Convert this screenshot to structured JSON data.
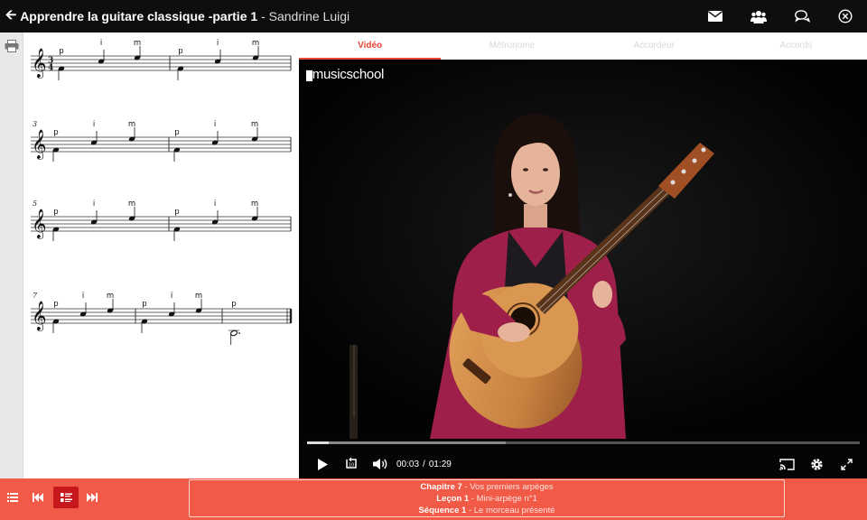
{
  "header": {
    "course_title": "Apprendre la guitare classique -partie 1",
    "separator": " - ",
    "author": "Sandrine Luigi"
  },
  "tabs": [
    {
      "label": "Vidéo",
      "active": true
    },
    {
      "label": "Métronome",
      "active": false
    },
    {
      "label": "Accordeur",
      "active": false
    },
    {
      "label": "Accords",
      "active": false
    }
  ],
  "video": {
    "logo_a": "music",
    "logo_b": "school",
    "current_time": "00:03",
    "duration": "01:29",
    "time_separator": "/",
    "played_fraction": 0.04,
    "buffered_fraction": 0.36
  },
  "score": {
    "systems": [
      {
        "number": "",
        "time_signature": [
          "3",
          "4"
        ],
        "fingering": [
          "p",
          "i",
          "m",
          "p",
          "i",
          "m"
        ]
      },
      {
        "number": "3",
        "fingering": [
          "p",
          "i",
          "m",
          "p",
          "i",
          "m"
        ]
      },
      {
        "number": "5",
        "fingering": [
          "p",
          "i",
          "m",
          "p",
          "i",
          "m"
        ]
      },
      {
        "number": "7",
        "fingering": [
          "p",
          "i",
          "m",
          "p",
          "i",
          "m",
          "p"
        ]
      }
    ]
  },
  "footer": {
    "chapter_label": "Chapitre 7",
    "chapter_title": "Vos premiers arpèges",
    "lesson_label": "Leçon 1",
    "lesson_title": "Mini-arpège n°1",
    "sequence_label": "Séquence 1",
    "sequence_title": "Le morceau présenté",
    "dash": " - "
  },
  "colors": {
    "accent": "#e94536",
    "footer_bg": "#f15a47",
    "active_button": "#c6171d",
    "topbar": "#0e0e0e"
  },
  "icons": {
    "back": "arrow-left-icon",
    "mail": "envelope-icon",
    "community": "users-icon",
    "chat": "chat-bubbles-icon",
    "close": "close-circle-icon",
    "print": "printer-icon",
    "play": "play-icon",
    "replay": "replay-10-icon",
    "volume": "volume-icon",
    "cast": "cast-icon",
    "settings": "gear-icon",
    "fullscreen": "fullscreen-icon",
    "list": "list-icon",
    "previous": "skip-previous-icon",
    "lesson": "lesson-list-icon",
    "next": "skip-next-icon"
  }
}
